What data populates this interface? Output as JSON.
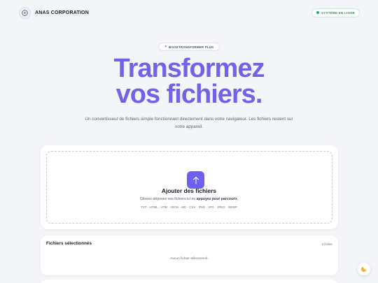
{
  "header": {
    "brand_name": "ANAS CORPORATION",
    "logo_icon": "gear-globe-icon",
    "status_text": "SYSTÈME EN LIGNE",
    "status_color": "#22b35e"
  },
  "hero": {
    "badge_icon": "sparkle-icon",
    "badge_text": "BOOKTRANSFORMER PLUS",
    "title_line1": "Transformez",
    "title_line2": "vos fichiers.",
    "subtitle": "Un convertisseur de fichiers simple fonctionnant directement dans votre navigateur. Les fichiers restent sur votre appareil.",
    "accent_color": "#7262ea"
  },
  "upload": {
    "icon": "upload-arrow-icon",
    "title": "Ajouter des fichiers",
    "hint_prefix": "Glissez-déposez vos fichiers ici ou ",
    "hint_link": "appuyez pour parcourir",
    "hint_suffix": ".",
    "formats": "TXT · HTML · HTM · JSON · MD · CSV · PNG · JPG · JPEG · WEBP"
  },
  "files": {
    "title": "Fichiers sélectionnés",
    "count": "0 fichier",
    "empty": "Aucun fichier sélectionné."
  },
  "theme_toggle": {
    "icon": "moon-icon"
  }
}
